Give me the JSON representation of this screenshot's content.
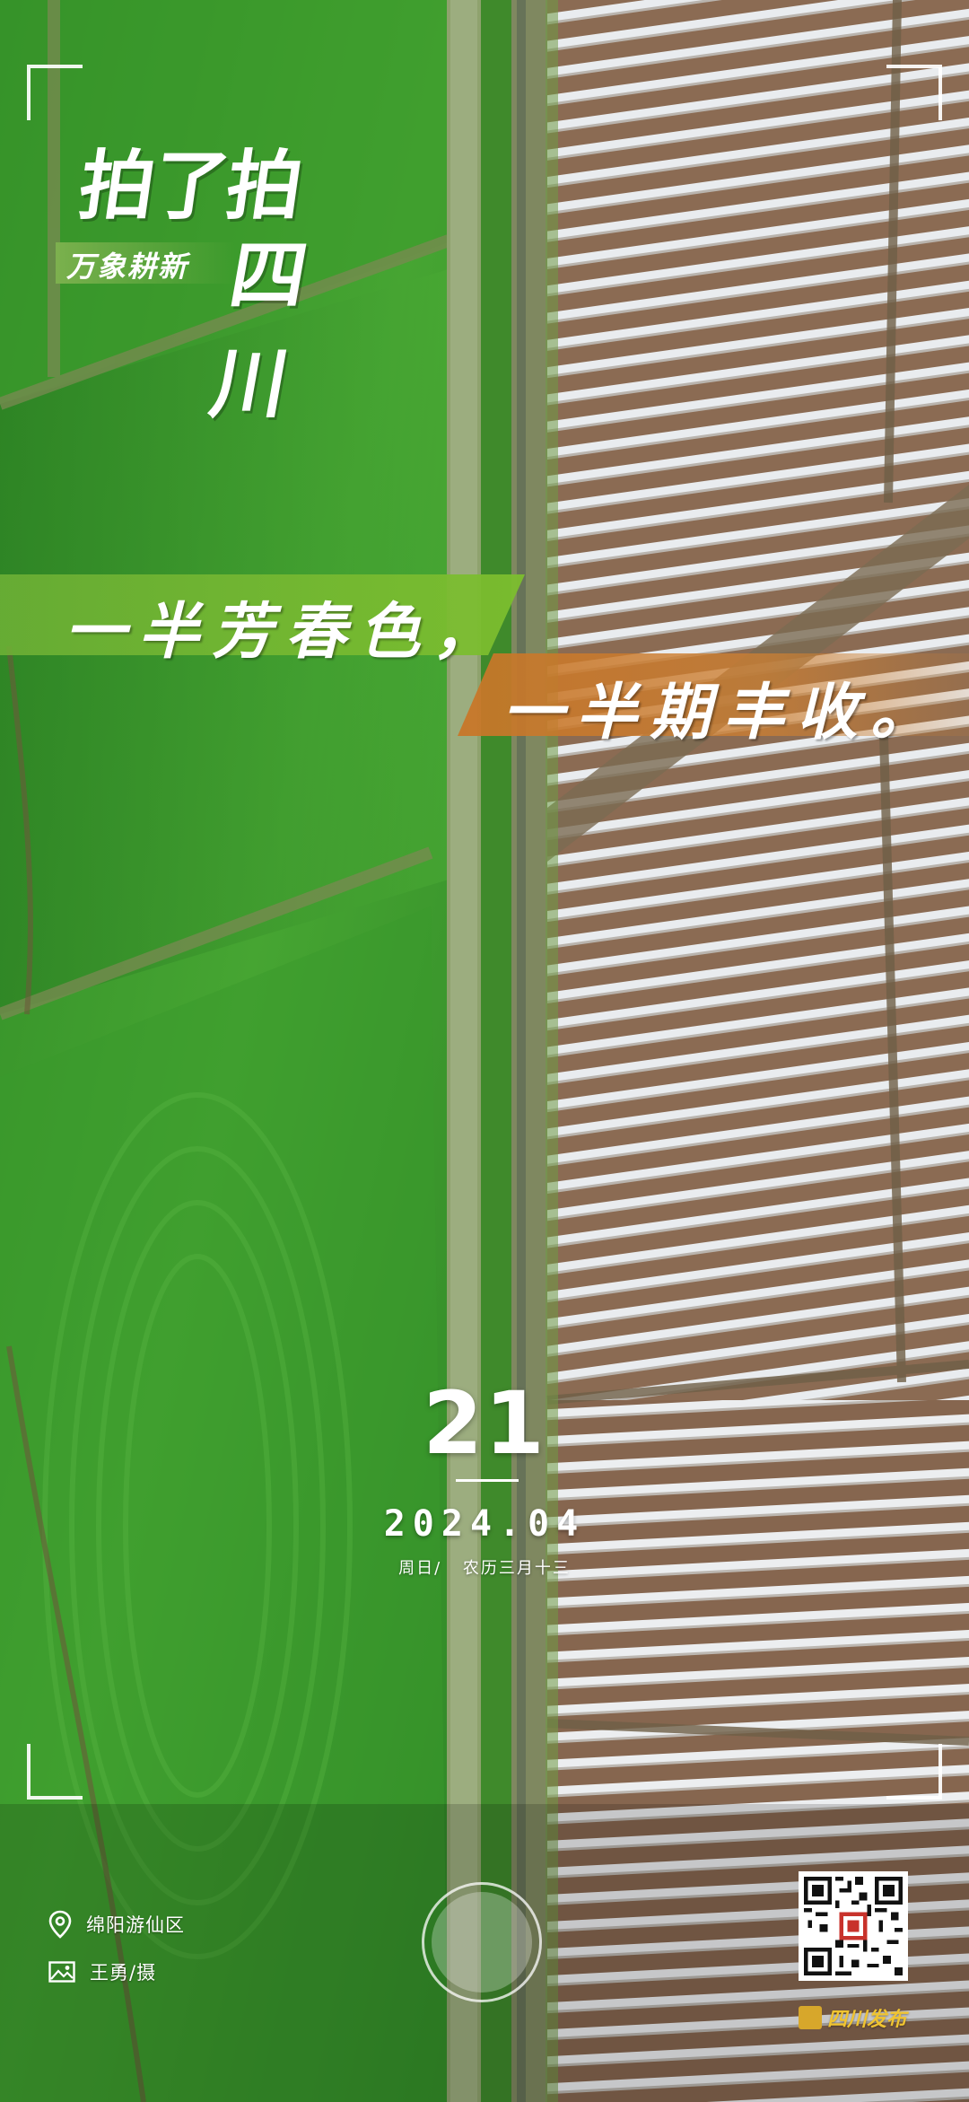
{
  "header": {
    "logo_main": "拍了拍",
    "logo_sub": "万象耕新",
    "logo_region": "四川"
  },
  "slogan": {
    "line1": "一半芳春色，",
    "line2": "一半期丰收。"
  },
  "date": {
    "day": "21",
    "year_month": "2024.04",
    "weekday": "周日/",
    "lunar": "农历三月十三"
  },
  "footer": {
    "location": "绵阳游仙区",
    "photographer": "王勇/摄",
    "brand": "四川发布"
  },
  "colors": {
    "green_banner": "#7cbe2e",
    "orange_banner": "#ce8032",
    "field_green": "#3f9a2a",
    "soil_brown": "#8a6a50",
    "brand_gold": "#f0c431"
  },
  "icons": {
    "location": "map-pin-icon",
    "photo": "image-icon",
    "shutter": "shutter-button",
    "qr": "qr-code"
  }
}
